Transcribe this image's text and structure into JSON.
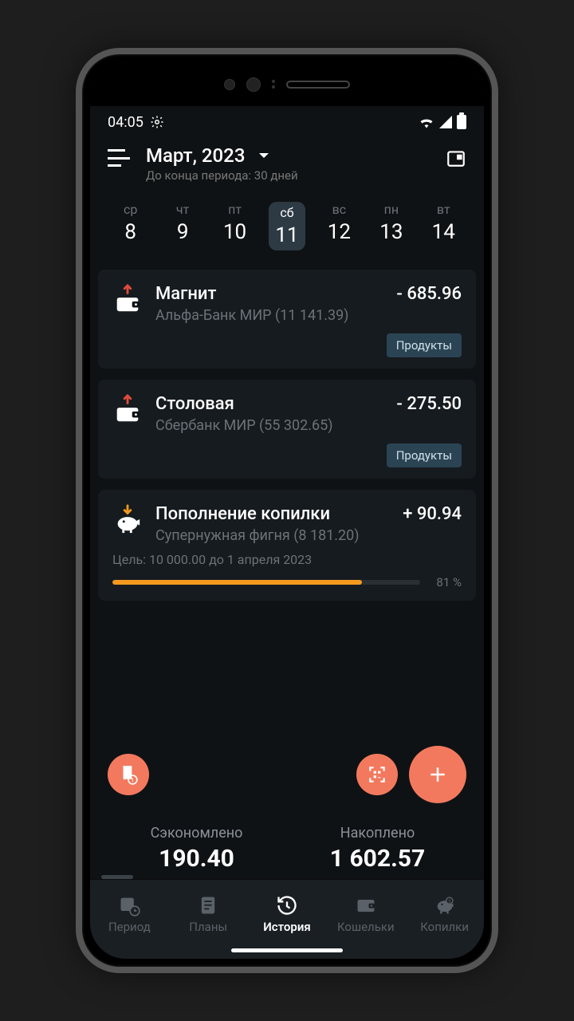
{
  "status": {
    "time": "04:05"
  },
  "header": {
    "month": "Март, 2023",
    "subtitle": "До конца периода: 30 дней"
  },
  "week": [
    {
      "label": "ср",
      "num": "8",
      "selected": false
    },
    {
      "label": "чт",
      "num": "9",
      "selected": false
    },
    {
      "label": "пт",
      "num": "10",
      "selected": false
    },
    {
      "label": "сб",
      "num": "11",
      "selected": true
    },
    {
      "label": "вс",
      "num": "12",
      "selected": false
    },
    {
      "label": "пн",
      "num": "13",
      "selected": false
    },
    {
      "label": "вт",
      "num": "14",
      "selected": false
    }
  ],
  "transactions": [
    {
      "type": "expense",
      "title": "Магнит",
      "subtitle": "Альфа-Банк МИР  (11 141.39)",
      "amount": "- 685.96",
      "tag": "Продукты"
    },
    {
      "type": "expense",
      "title": "Столовая",
      "subtitle": "Сбербанк МИР  (55 302.65)",
      "amount": "- 275.50",
      "tag": "Продукты"
    },
    {
      "type": "saving",
      "title": "Пополнение копилки",
      "subtitle": "Супернужная фигня  (8 181.20)",
      "amount": "+ 90.94",
      "goal": "Цель: 10 000.00 до 1 апреля 2023",
      "progress_pct": 81,
      "progress_label": "81 %"
    }
  ],
  "summary": {
    "saved_label": "Сэкономлено",
    "saved_value": "190.40",
    "accum_label": "Накоплено",
    "accum_value": "1 602.57"
  },
  "nav": {
    "period": "Период",
    "plans": "Планы",
    "history": "История",
    "wallets": "Кошельки",
    "piggy": "Копилки"
  }
}
